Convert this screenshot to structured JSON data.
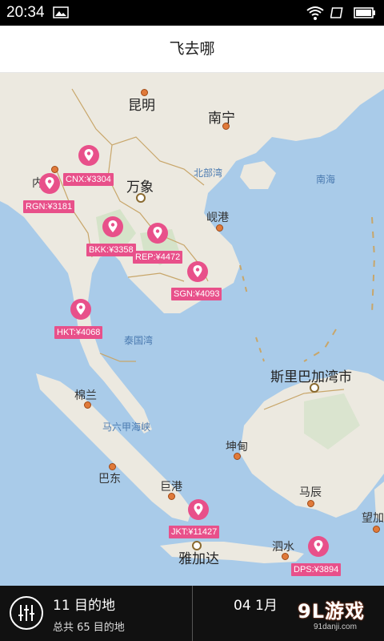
{
  "status_bar": {
    "time": "20:34"
  },
  "header": {
    "title": "飞去哪"
  },
  "map": {
    "cities": {
      "kunming": "昆明",
      "nanning": "南宁",
      "vientiane": "万象",
      "haiphong": "岘港",
      "kota_kinabalu": "斯里巴加湾市",
      "medan": "棉兰",
      "padang": "巴东",
      "palembang": "巨港",
      "jakarta": "雅加达",
      "pontianak": "坤甸",
      "banjarmasin": "马辰",
      "surabaya": "泗水",
      "other_left": "内",
      "other_right": "望加"
    },
    "seas": {
      "beibu": "北部湾",
      "south_china_sea": "南海",
      "gulf_of_thailand": "泰国湾",
      "malacca": "马六甲海峡"
    },
    "markers": [
      {
        "code": "CNX:¥3304"
      },
      {
        "code": "RGN:¥3181"
      },
      {
        "code": "BKK:¥3358"
      },
      {
        "code": "REP:¥4472"
      },
      {
        "code": "SGN:¥4093"
      },
      {
        "code": "HKT:¥4068"
      },
      {
        "code": "JKT:¥11427"
      },
      {
        "code": "DPS:¥3894"
      }
    ],
    "marker_color": "#e8508a"
  },
  "bottom_bar": {
    "destination_count": "11 目的地",
    "destination_total": "总共 65 目的地",
    "date": "04 1月"
  },
  "watermark": {
    "main": "9L游戏",
    "sub": "91danji.com"
  }
}
